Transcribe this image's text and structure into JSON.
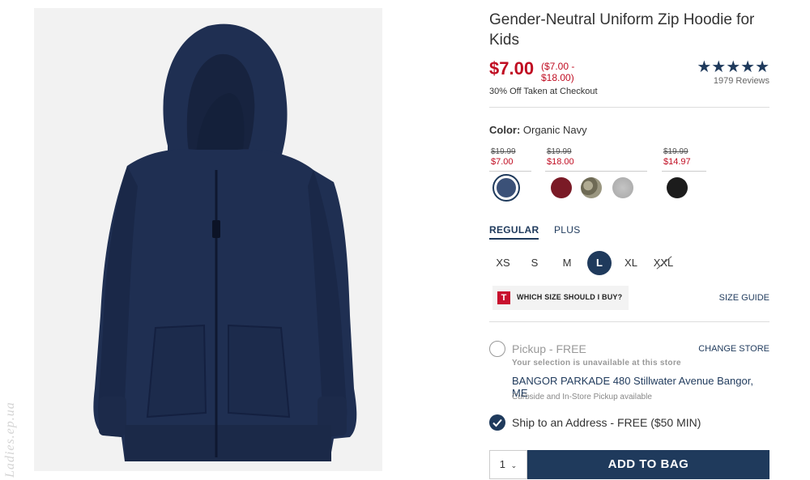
{
  "product": {
    "title": "Gender-Neutral Uniform Zip Hoodie for Kids",
    "price": "$7.00",
    "price_range": "($7.00 - $18.00)",
    "rating_stars": 5,
    "reviews": "1979 Reviews",
    "promo": "30% Off Taken at Checkout"
  },
  "color": {
    "label": "Color:",
    "selected": "Organic Navy",
    "price_groups": [
      {
        "was": "$19.99",
        "now": "$7.00"
      },
      {
        "was": "$19.99",
        "now": "$18.00"
      },
      {
        "was": "$19.99",
        "now": "$14.97"
      }
    ],
    "swatches": [
      {
        "name": "Organic Navy",
        "color": "#3b5178",
        "selected": true
      },
      {
        "name": "Burgundy",
        "color": "#7a1a26"
      },
      {
        "name": "Camo",
        "color": "#8a8670"
      },
      {
        "name": "Heather Gray",
        "color": "#b4b4b4"
      },
      {
        "name": "Black",
        "color": "#1c1c1c"
      }
    ]
  },
  "size_tabs": [
    "REGULAR",
    "PLUS"
  ],
  "sizes": [
    {
      "label": "XS"
    },
    {
      "label": "S"
    },
    {
      "label": "M"
    },
    {
      "label": "L",
      "selected": true
    },
    {
      "label": "XL"
    },
    {
      "label": "XXL",
      "unavailable": true
    }
  ],
  "fit": {
    "logo": "T",
    "label": "WHICH SIZE SHOULD I BUY?",
    "size_guide": "SIZE GUIDE"
  },
  "fulfillment": {
    "pickup_label": "Pickup - FREE",
    "change_store": "CHANGE STORE",
    "unavailable_note": "Your selection is unavailable at this store",
    "store_address": "BANGOR PARKADE 480 Stillwater Avenue Bangor, ME",
    "curbside_note": "Curbside and In-Store Pickup available",
    "ship_label": "Ship to an Address - FREE ($50 MIN)"
  },
  "cart": {
    "quantity": "1",
    "add_to_bag": "ADD TO BAG"
  },
  "watermark": "Ladies.ep.ua",
  "colors": {
    "brand_navy": "#1f3a5c",
    "sale_red": "#c00d22",
    "hoodie": "#1f2f52"
  }
}
